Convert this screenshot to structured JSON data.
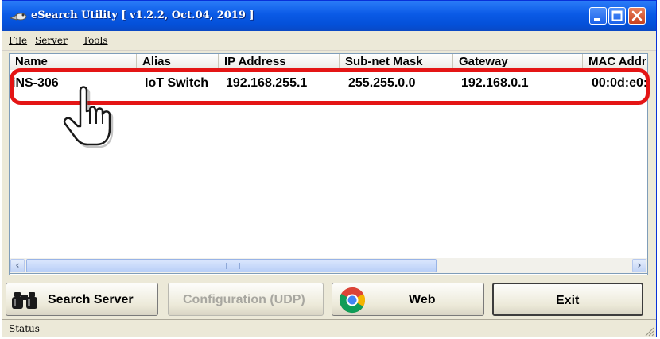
{
  "window": {
    "title": "eSearch Utility [ v1.2.2, Oct.04, 2019 ]",
    "title_icon": "esearch-app-icon",
    "controls": {
      "minimize_icon": "minimize-icon",
      "maximize_icon": "maximize-icon",
      "close_icon": "close-icon"
    }
  },
  "menu": {
    "items": [
      "File",
      "Server",
      "Tools"
    ]
  },
  "table": {
    "columns": [
      "Name",
      "Alias",
      "IP Address",
      "Sub-net Mask",
      "Gateway",
      "MAC Addr"
    ],
    "rows": [
      {
        "name": "iNS-306",
        "alias": "IoT Switch",
        "ip": "192.168.255.1",
        "mask": "255.255.0.0",
        "gateway": "192.168.0.1",
        "mac": "00:0d:e0:"
      }
    ]
  },
  "annotation": {
    "highlight_color": "#e41515",
    "pointer_icon": "hand-pointer-icon"
  },
  "scrollbar": {
    "left_icon": "scroll-left-arrow-icon",
    "right_icon": "scroll-right-arrow-icon"
  },
  "buttons": {
    "search": {
      "label": "Search Server",
      "icon": "binoculars-icon"
    },
    "config": {
      "label": "Configuration (UDP)",
      "enabled": false
    },
    "web": {
      "label": "Web",
      "icon": "chrome-icon"
    },
    "exit": {
      "label": "Exit"
    }
  },
  "status": {
    "text": "Status"
  },
  "colors": {
    "titlebar": "#0a5ae6",
    "window_bg": "#ece9d8",
    "close_button": "#c9411e"
  }
}
